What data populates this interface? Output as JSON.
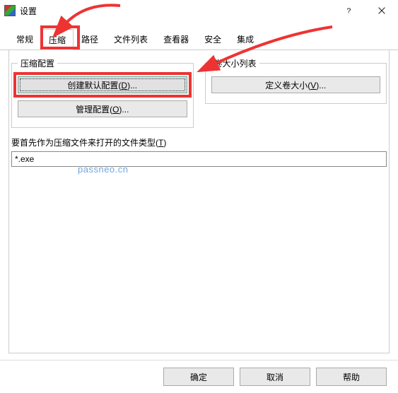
{
  "window": {
    "title": "设置"
  },
  "tabs": {
    "items": [
      {
        "label": "常规"
      },
      {
        "label": "压缩"
      },
      {
        "label": "路径"
      },
      {
        "label": "文件列表"
      },
      {
        "label": "查看器"
      },
      {
        "label": "安全"
      },
      {
        "label": "集成"
      }
    ],
    "active_index": 1
  },
  "groups": {
    "compress_config": {
      "legend": "压缩配置",
      "create_default": {
        "prefix": "创建默认配置(",
        "hotkey": "D",
        "suffix": ")..."
      },
      "manage": {
        "prefix": "管理配置(",
        "hotkey": "O",
        "suffix": ")..."
      }
    },
    "volume_list": {
      "legend": "卷大小列表",
      "define": {
        "prefix": "定义卷大小(",
        "hotkey": "V",
        "suffix": ")..."
      }
    }
  },
  "file_type": {
    "label_prefix": "要首先作为压缩文件来打开的文件类型(",
    "label_hotkey": "T",
    "label_suffix": ")",
    "value": "*.exe"
  },
  "footer": {
    "ok": "确定",
    "cancel": "取消",
    "help": "帮助"
  },
  "watermark": "passneo.cn"
}
